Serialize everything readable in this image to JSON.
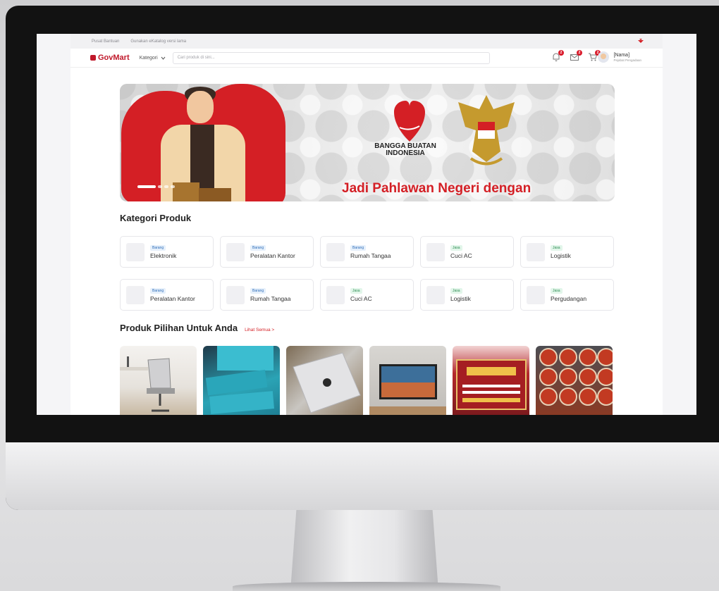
{
  "topbar": {
    "help_link": "Pusat Bantuan",
    "old_version_link": "Gunakan eKatalog versi lama"
  },
  "navbar": {
    "logo_text": "GovMart",
    "category_label": "Kategori",
    "search_placeholder": "Cari produk di sini...",
    "notif_count": "2",
    "message_count": "2",
    "cart_count": "2",
    "user_name": "[Nama]",
    "user_role": "Pejabat Pengadaan"
  },
  "banner": {
    "badge_text": "BANGGA BUATAN INDONESIA",
    "tagline": "Jadi Pahlawan Negeri dengan"
  },
  "categories": {
    "title": "Kategori Produk",
    "items": [
      {
        "type": "Barang",
        "name": "Elektronik"
      },
      {
        "type": "Barang",
        "name": "Peralatan Kantor"
      },
      {
        "type": "Barang",
        "name": "Rumah Tangaa"
      },
      {
        "type": "Jasa",
        "name": "Cuci AC"
      },
      {
        "type": "Jasa",
        "name": "Logistik"
      },
      {
        "type": "Barang",
        "name": "Peralatan Kantor"
      },
      {
        "type": "Barang",
        "name": "Rumah Tangaa"
      },
      {
        "type": "Jasa",
        "name": "Cuci AC"
      },
      {
        "type": "Jasa",
        "name": "Logistik"
      },
      {
        "type": "Jasa",
        "name": "Pergudangan"
      }
    ]
  },
  "products": {
    "title": "Produk Pilihan Untuk Anda",
    "see_all": "Lihat Semua >"
  },
  "colors": {
    "brand": "#c0182a",
    "banner_red": "#d41f25"
  }
}
